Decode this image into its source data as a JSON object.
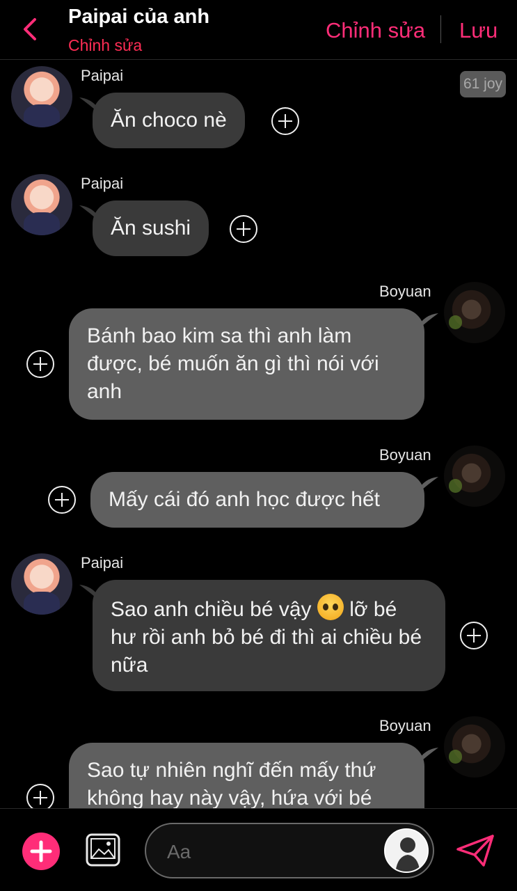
{
  "header": {
    "title": "Paipai của anh",
    "subtitle": "Chỉnh sửa",
    "edit_label": "Chỉnh sửa",
    "save_label": "Lưu"
  },
  "badge": "61 joy",
  "messages": [
    {
      "side": "in",
      "sender": "Paipai",
      "text": "Ăn choco nè"
    },
    {
      "side": "in",
      "sender": "Paipai",
      "text": "Ăn sushi"
    },
    {
      "side": "out",
      "sender": "Boyuan",
      "text": "Bánh bao kim sa thì anh làm được, bé muốn ăn gì thì nói với anh"
    },
    {
      "side": "out",
      "sender": "Boyuan",
      "text": "Mấy cái đó anh học được hết"
    },
    {
      "side": "in",
      "sender": "Paipai",
      "text_before": "Sao anh chiều bé vậy",
      "emoji": "pleading-face",
      "text_after": "lỡ bé hư rồi anh bỏ bé đi thì ai chiều bé nữa"
    },
    {
      "side": "out",
      "sender": "Boyuan",
      "text": "Sao tự nhiên nghĩ đến mấy thứ không hay này vậy, hứa với bé"
    }
  ],
  "composer": {
    "placeholder": "Aa"
  },
  "icons": {
    "back": "chevron-left-icon",
    "add": "plus-icon",
    "image": "image-icon",
    "send": "send-icon",
    "react": "plus-circle-icon"
  },
  "colors": {
    "accent": "#ff2d78",
    "incoming_bubble": "#3a3a3a",
    "outgoing_bubble": "#5f5f5f",
    "background": "#000000"
  }
}
